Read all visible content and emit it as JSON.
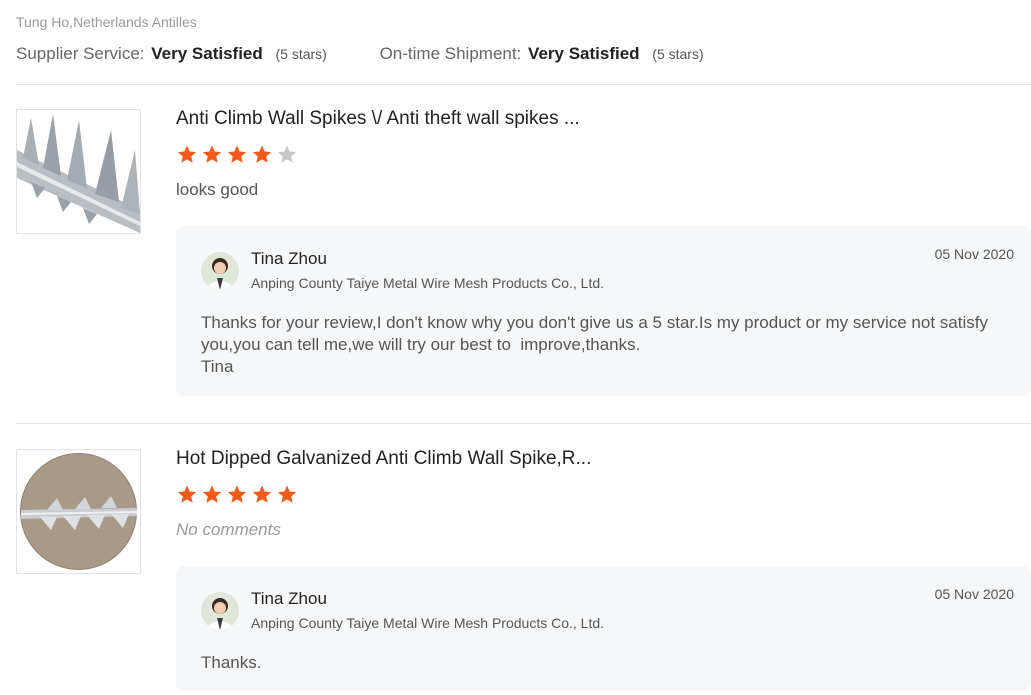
{
  "buyer": {
    "name_location": "Tung Ho,Netherlands Antilles",
    "supplier_service_label": "Supplier Service:",
    "supplier_service_value": "Very Satisfied",
    "supplier_service_stars": "(5 stars)",
    "shipment_label": "On-time Shipment:",
    "shipment_value": "Very Satisfied",
    "shipment_stars": "(5 stars)"
  },
  "colors": {
    "star_filled": "#f25a1b",
    "star_empty": "#c8c8c8",
    "reply_bg": "#f6f7f8"
  },
  "reviews": [
    {
      "product_title": "Anti Climb Wall Spikes \\/ Anti theft wall spikes ...",
      "rating": 4,
      "rating_max": 5,
      "comment": "looks good",
      "product_image_icon": "wall-spikes-photo",
      "reply": {
        "name": "Tina Zhou",
        "company": "Anping County Taiye Metal Wire Mesh Products Co., Ltd.",
        "date": "05 Nov 2020",
        "text_lines": [
          "Thanks for your review,I don't know why you don't give us a 5 star.Is my product or my service not satisfy",
          "you,you can tell me,we will try our best to  improve,thanks.",
          "Tina"
        ]
      }
    },
    {
      "product_title": "Hot Dipped Galvanized Anti Climb Wall Spike,R...",
      "rating": 5,
      "rating_max": 5,
      "comment": "No comments",
      "product_image_icon": "galvanized-spike-photo",
      "reply": {
        "name": "Tina Zhou",
        "company": "Anping County Taiye Metal Wire Mesh Products Co., Ltd.",
        "date": "05 Nov 2020",
        "text_lines": [
          "Thanks."
        ]
      }
    }
  ]
}
